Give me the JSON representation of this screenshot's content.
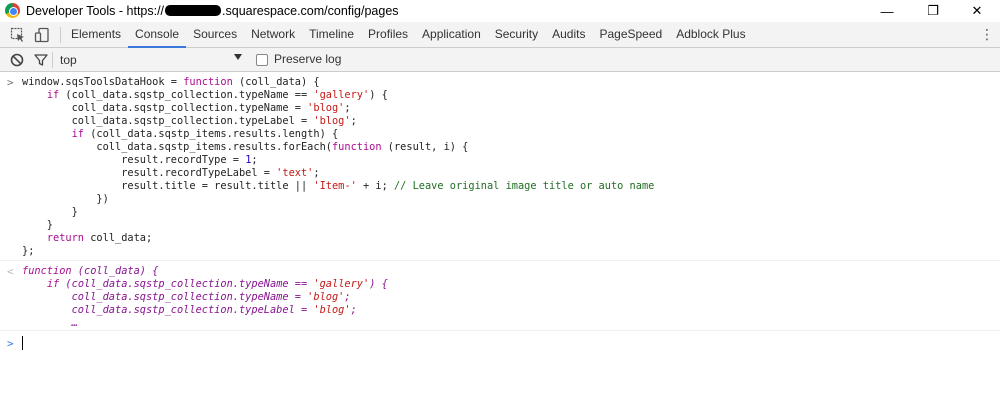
{
  "window": {
    "title_prefix": "Developer Tools - https://",
    "title_suffix": ".squarespace.com/config/pages",
    "minimize": "—",
    "restore": "❐",
    "close": "✕"
  },
  "tabs": [
    {
      "label": "Elements",
      "active": false
    },
    {
      "label": "Console",
      "active": true
    },
    {
      "label": "Sources",
      "active": false
    },
    {
      "label": "Network",
      "active": false
    },
    {
      "label": "Timeline",
      "active": false
    },
    {
      "label": "Profiles",
      "active": false
    },
    {
      "label": "Application",
      "active": false
    },
    {
      "label": "Security",
      "active": false
    },
    {
      "label": "Audits",
      "active": false
    },
    {
      "label": "PageSpeed",
      "active": false
    },
    {
      "label": "Adblock Plus",
      "active": false
    }
  ],
  "icons": {
    "inspect": "inspect-element-icon",
    "device": "device-toolbar-icon",
    "more": "kebab-menu-icon",
    "clear": "clear-console-icon",
    "filter": "filter-icon",
    "dropdown": "chevron-down-icon"
  },
  "console_toolbar": {
    "context": "top",
    "preserve_log_label": "Preserve log",
    "preserve_log_checked": false
  },
  "console": {
    "input_prompt": ">",
    "result_prompt": "<",
    "active_prompt": ">",
    "input_lines": [
      "window.sqsToolsDataHook = function (coll_data) {",
      "    if (coll_data.sqstp_collection.typeName == 'gallery') {",
      "        coll_data.sqstp_collection.typeName = 'blog';",
      "        coll_data.sqstp_collection.typeLabel = 'blog';",
      "        if (coll_data.sqstp_items.results.length) {",
      "            coll_data.sqstp_items.results.forEach(function (result, i) {",
      "                result.recordType = 1;",
      "                result.recordTypeLabel = 'text';",
      "                result.title = result.title || 'Item-' + i; // Leave original image title or auto name",
      "            })",
      "        }",
      "    }",
      "    return coll_data;",
      "};"
    ],
    "result_lines": [
      "function (coll_data) {",
      "    if (coll_data.sqstp_collection.typeName == 'gallery') {",
      "        coll_data.sqstp_collection.typeName = 'blog';",
      "        coll_data.sqstp_collection.typeLabel = 'blog';",
      "        …"
    ]
  }
}
